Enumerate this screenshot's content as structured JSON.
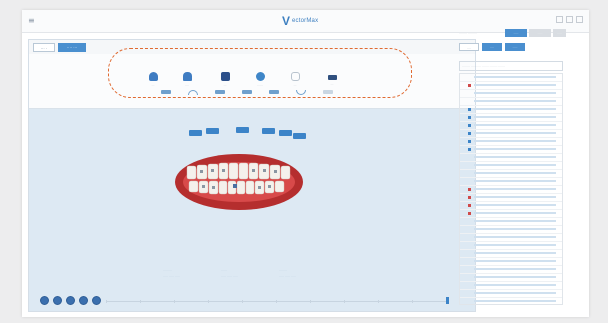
{
  "app": {
    "logo_mark": "V",
    "logo_text": "ectorMax"
  },
  "tabs": [
    {
      "label": "··· ·"
    },
    {
      "label": "···· ···"
    }
  ],
  "toolbar": {
    "tools": [
      {
        "icon": "tooth-view-icon",
        "label": "···"
      },
      {
        "icon": "bell-icon",
        "label": "····"
      },
      {
        "icon": "bracket-icon",
        "label": "···"
      },
      {
        "icon": "globe-icon",
        "label": "······"
      },
      {
        "icon": "ruler-icon",
        "label": "···"
      },
      {
        "icon": "film-icon",
        "label": "···"
      }
    ],
    "view_buttons": [
      {
        "icon": "view-front-icon"
      },
      {
        "icon": "view-arch-icon"
      },
      {
        "icon": "view-left-icon"
      },
      {
        "icon": "view-right-icon"
      },
      {
        "icon": "view-top-icon"
      },
      {
        "icon": "view-bottom-icon"
      },
      {
        "icon": "view-reset-icon"
      }
    ]
  },
  "legend": {
    "groups": [
      {
        "title": "·········",
        "items": "·····  ·····  ·····"
      },
      {
        "title": "······",
        "items": "·····  ·····  ·····"
      },
      {
        "title": "········",
        "items": "·····  ·····  ·····"
      }
    ]
  },
  "playback": {
    "buttons": [
      {
        "icon": "skip-back-icon"
      },
      {
        "icon": "step-back-icon"
      },
      {
        "icon": "play-icon"
      },
      {
        "icon": "step-forward-icon"
      },
      {
        "icon": "skip-forward-icon"
      }
    ]
  },
  "right_panel": {
    "label": "········ ·········",
    "buttons": [
      {
        "label": "·····",
        "color": "#4a8fcf"
      },
      {
        "label": "·····",
        "color": "#d9dde2"
      },
      {
        "label": "·····",
        "color": "#d9dde2"
      }
    ],
    "tabs": [
      {
        "label": "····"
      },
      {
        "label": "····"
      },
      {
        "label": "·····"
      }
    ],
    "header": "········ ·········· ······· ········ ·······"
  },
  "colors": {
    "accent": "#4a8fcf",
    "highlight": "#e06a31",
    "dark_button": "#3b6fae"
  }
}
